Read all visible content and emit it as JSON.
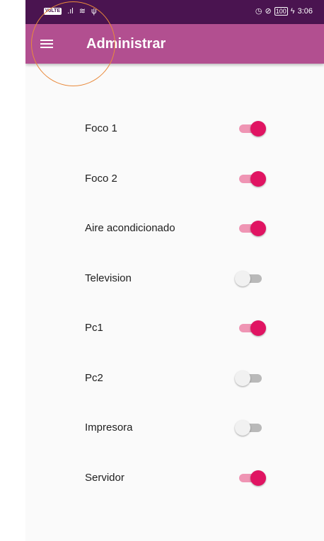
{
  "status_bar": {
    "network_badge": "VoLTE",
    "signal_glyph": ".ıl",
    "wifi_glyph": "≋",
    "usb_glyph": "ψ",
    "alarm_glyph": "◷",
    "speed_glyph": "⊘",
    "battery_level": "100",
    "charging_glyph": "ϟ",
    "time": "3:06"
  },
  "app_bar": {
    "title": "Administrar",
    "menu_icon": "hamburger-menu-icon"
  },
  "devices": [
    {
      "label": "Foco 1",
      "on": true
    },
    {
      "label": "Foco 2",
      "on": true
    },
    {
      "label": "Aire acondicionado",
      "on": true
    },
    {
      "label": "Television",
      "on": false
    },
    {
      "label": "Pc1",
      "on": true
    },
    {
      "label": "Pc2",
      "on": false
    },
    {
      "label": "Impresora",
      "on": false
    },
    {
      "label": "Servidor",
      "on": true
    }
  ],
  "colors": {
    "status_bar": "#4a1450",
    "app_bar": "#b24f90",
    "switch_on_thumb": "#e01462",
    "switch_on_track": "#ef95b4",
    "switch_off_thumb": "#f1f1f1",
    "switch_off_track": "#b9b9b9",
    "annotation_circle": "#e98a3c"
  }
}
